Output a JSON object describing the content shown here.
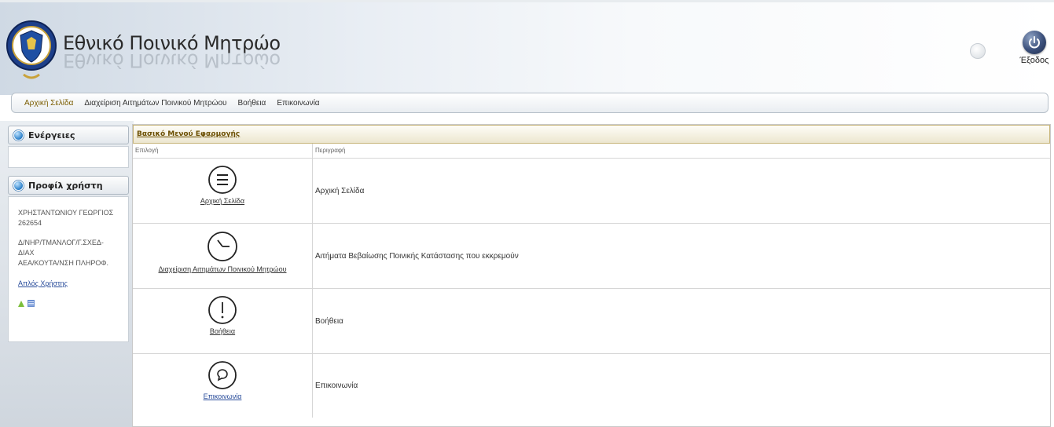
{
  "header": {
    "title": "Εθνικό Ποινικό Μητρώο",
    "exit_label": "Έξοδος"
  },
  "topnav": {
    "items": [
      {
        "label": "Αρχική Σελίδα",
        "active": true
      },
      {
        "label": "Διαχείριση Αιτημάτων Ποινικού Μητρώου",
        "active": false
      },
      {
        "label": "Βοήθεια",
        "active": false
      },
      {
        "label": "Επικοινωνία",
        "active": false
      }
    ]
  },
  "sidebar": {
    "actions_title": "Ενέργειες",
    "profile_title": "Προφίλ χρήστη",
    "profile_name_line1": "ΧΡΗΣΤΑΝΤΩΝΙΟΥ ΓΕΩΡΓΙΟΣ",
    "profile_name_line2": "262654",
    "profile_org_line1": "Δ/ΝΗΡ/ΤΜΑΝΛΟΓ/Γ.ΣΧΕΔ-ΔΙΑΧ",
    "profile_org_line2": "ΑΕΑ/ΚΟΥΤΑ/ΝΣΗ ΠΛΗΡΟΦ.",
    "user_link": "Απλός Χρήστης"
  },
  "main": {
    "title": "Βασικό Μενού Εφαρμογής",
    "col_option": "Επιλογή",
    "col_description": "Περιγραφή",
    "rows": [
      {
        "icon": "menu-icon",
        "label": "Αρχική Σελίδα",
        "description": "Αρχική Σελίδα"
      },
      {
        "icon": "clock-icon",
        "label": "Διαχείριση Αιτημάτων Ποινικού Μητρώου",
        "description": "Αιτήματα Βεβαίωσης Ποινικής Κατάστασης που εκκρεμούν"
      },
      {
        "icon": "exclamation-icon",
        "label": "Βοήθεια",
        "description": "Βοήθεια"
      },
      {
        "icon": "chat-bubble-icon",
        "label": "Επικοινωνία",
        "description": "Επικοινωνία"
      }
    ]
  },
  "colors": {
    "nav_active": "#7a5c00",
    "link_blue": "#2a4d9b",
    "title_brown": "#6b4e00"
  }
}
